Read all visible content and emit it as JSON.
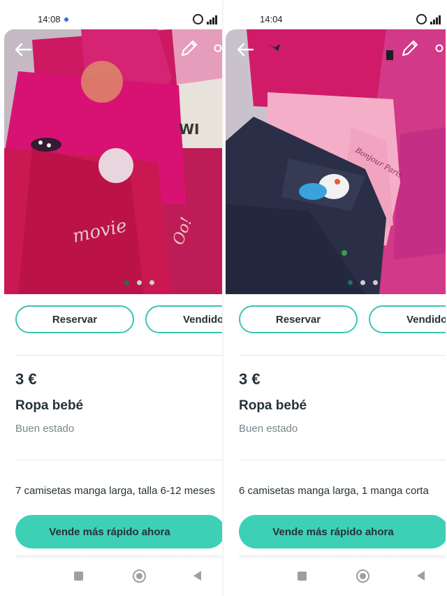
{
  "colors": {
    "accent": "#3ecfb7",
    "accent_border": "#3bc4b1",
    "text": "#253238",
    "muted": "#7a868c"
  },
  "screens": [
    {
      "status": {
        "time": "14:08"
      },
      "photo": {
        "subject": "clothes-pile-pink",
        "carousel_count": 3,
        "carousel_active": 1
      },
      "actions": {
        "reserve_label": "Reservar",
        "sold_label": "Vendido"
      },
      "listing": {
        "price": "3 €",
        "title": "Ropa bebé",
        "condition": "Buen estado",
        "description": "7 camisetas manga larga, talla 6-12 meses"
      },
      "cta_label": "Vende más rápido ahora"
    },
    {
      "status": {
        "time": "14:04"
      },
      "photo": {
        "subject": "clothes-pile-navy-pink",
        "carousel_count": 3,
        "carousel_active": 1
      },
      "actions": {
        "reserve_label": "Reservar",
        "sold_label": "Vendido"
      },
      "listing": {
        "price": "3 €",
        "title": "Ropa bebé",
        "condition": "Buen estado",
        "description": "6 camisetas manga larga, 1 manga corta"
      },
      "cta_label": "Vende más rápido ahora"
    }
  ],
  "icons": {
    "back": "arrow-left-icon",
    "edit": "pencil-icon",
    "share": "share-icon",
    "alarm": "alarm-clock-icon",
    "signal": "signal-icon"
  }
}
